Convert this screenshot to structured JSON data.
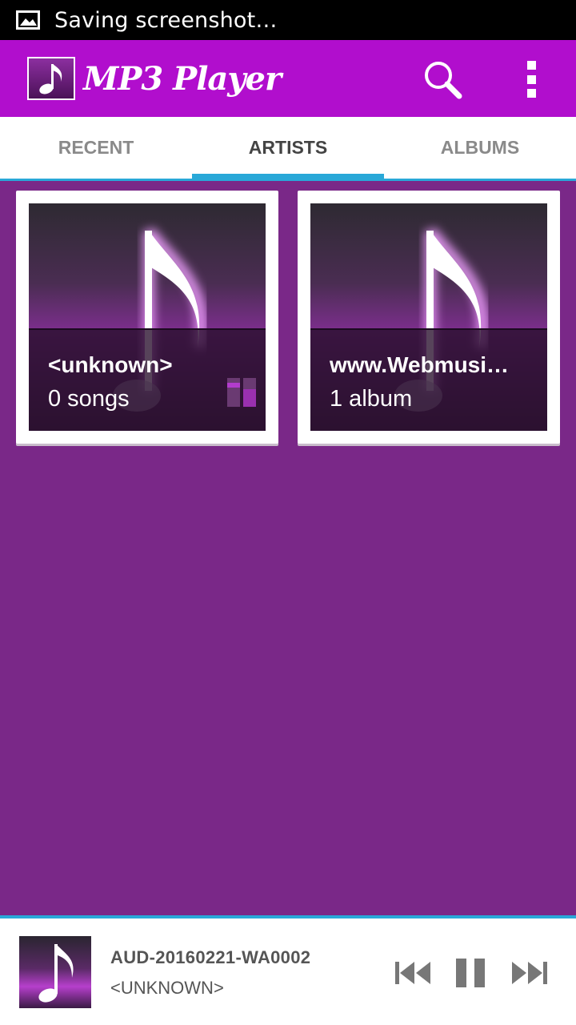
{
  "status_bar": {
    "text": "Saving screenshot…",
    "icon": "image-icon"
  },
  "app_bar": {
    "title": "MP3 Player",
    "logo_icon": "music-note-icon",
    "search_icon": "search-icon",
    "menu_icon": "more-vert-icon",
    "color": "#b10ecd"
  },
  "tabs": [
    {
      "label": "RECENT",
      "active": false
    },
    {
      "label": "ARTISTS",
      "active": true
    },
    {
      "label": "ALBUMS",
      "active": false
    }
  ],
  "artists": [
    {
      "name": "<unknown>",
      "count": "0 songs",
      "playing": true
    },
    {
      "name": "www.Webmusi…",
      "count": "1 album",
      "playing": false
    }
  ],
  "now_playing": {
    "title": "AUD-20160221-WA0002",
    "artist": "<UNKNOWN>",
    "controls": [
      "previous-icon",
      "pause-icon",
      "next-icon"
    ]
  },
  "colors": {
    "background": "#7a2888",
    "accent": "#29a8d8",
    "toolbar": "#b10ecd"
  }
}
